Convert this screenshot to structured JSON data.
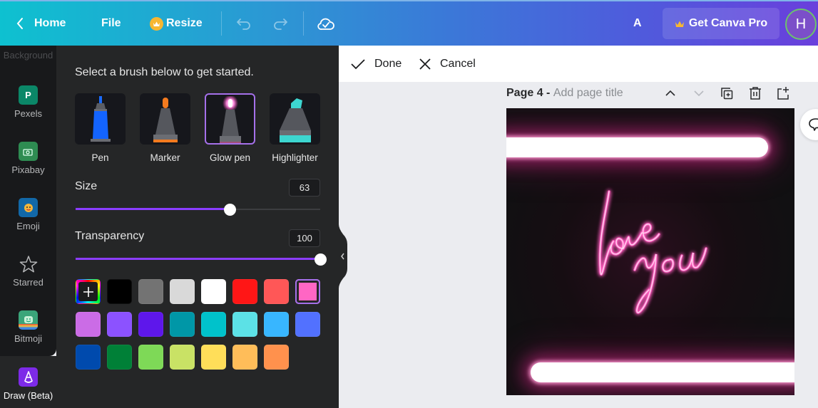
{
  "topbar": {
    "home_label": "Home",
    "file_label": "File",
    "resize_label": "Resize",
    "undo_icon": "undo-icon",
    "redo_icon": "redo-icon",
    "cloud_icon": "cloud-check-icon",
    "text_a": "A",
    "pro_label": "Get Canva Pro",
    "avatar_initial": "H",
    "colors": {
      "crown": "#f7b731",
      "avatar_bg": "#7b4fc9",
      "avatar_ring": "#6cc36c"
    }
  },
  "rail": {
    "partial_label": "Background",
    "items": [
      {
        "label": "Pexels",
        "icon": "pexels-icon",
        "color": "#0b8768"
      },
      {
        "label": "Pixabay",
        "icon": "pixabay-icon",
        "color": "#2e8c52"
      },
      {
        "label": "Emoji",
        "icon": "emoji-icon",
        "color": "#1268a8"
      },
      {
        "label": "Starred",
        "icon": "star-icon"
      },
      {
        "label": "Bitmoji",
        "icon": "bitmoji-icon",
        "color": "#3aa57a"
      },
      {
        "label": "Draw (Beta)",
        "icon": "draw-icon",
        "color": "#7d2ae8",
        "active": true
      }
    ]
  },
  "panel": {
    "intro": "Select a brush below to get started.",
    "brushes": [
      {
        "label": "Pen",
        "selected": false
      },
      {
        "label": "Marker",
        "selected": false
      },
      {
        "label": "Glow pen",
        "selected": true
      },
      {
        "label": "Highlighter",
        "selected": false
      }
    ],
    "size": {
      "label": "Size",
      "value": "63",
      "fraction": 0.63
    },
    "transparency": {
      "label": "Transparency",
      "value": "100",
      "fraction": 1.0
    },
    "accent": "#8b3dff",
    "add_color_label": "+",
    "swatches": [
      [
        "#000000",
        "#737373",
        "#d9d9d9",
        "#ffffff",
        "#ff1616",
        "#ff5757",
        "#ff66c4"
      ],
      [
        "#cb6ce6",
        "#8c52ff",
        "#5e17eb",
        "#0097a7",
        "#00c2cb",
        "#5ce1e6",
        "#38b6ff",
        "#5271ff"
      ],
      [
        "#004aad",
        "#008037",
        "#7ed957",
        "#c9e265",
        "#ffde59",
        "#ffbd59",
        "#ff914d"
      ]
    ],
    "selected_swatch": "#ff66c4"
  },
  "editbar": {
    "done_label": "Done",
    "cancel_label": "Cancel"
  },
  "page": {
    "title_prefix": "Page 4 - ",
    "title_placeholder": "Add page title",
    "canvas_text": "love you",
    "neon_color": "#ff5fc0"
  }
}
